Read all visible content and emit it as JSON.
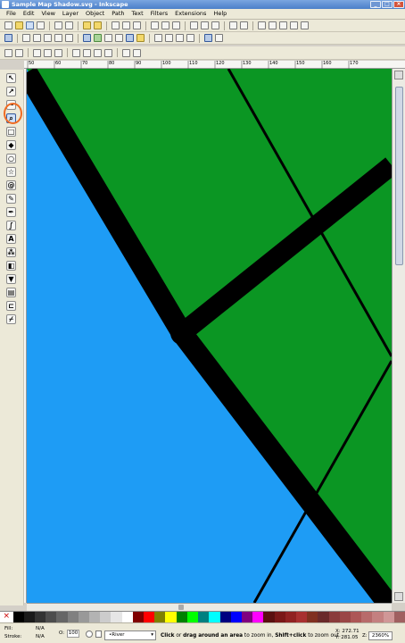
{
  "window": {
    "title": "Sample Map Shadow.svg - Inkscape",
    "minimize": "_",
    "maximize": "□",
    "close": "×"
  },
  "menus": [
    "File",
    "Edit",
    "View",
    "Layer",
    "Object",
    "Path",
    "Text",
    "Filters",
    "Extensions",
    "Help"
  ],
  "tools": [
    {
      "name": "selector-tool-icon",
      "glyph": "↖"
    },
    {
      "name": "node-tool-icon",
      "glyph": "↗"
    },
    {
      "name": "tweak-tool-icon",
      "glyph": "~"
    },
    {
      "name": "zoom-tool-icon",
      "glyph": "⌕",
      "active": true
    },
    {
      "name": "rectangle-tool-icon",
      "glyph": "□"
    },
    {
      "name": "3d-box-tool-icon",
      "glyph": "◆"
    },
    {
      "name": "ellipse-tool-icon",
      "glyph": "○"
    },
    {
      "name": "star-tool-icon",
      "glyph": "☆"
    },
    {
      "name": "spiral-tool-icon",
      "glyph": "@"
    },
    {
      "name": "pencil-tool-icon",
      "glyph": "✎"
    },
    {
      "name": "pen-tool-icon",
      "glyph": "✒"
    },
    {
      "name": "calligraphy-tool-icon",
      "glyph": "∫"
    },
    {
      "name": "text-tool-icon",
      "glyph": "A"
    },
    {
      "name": "spray-tool-icon",
      "glyph": "⁂"
    },
    {
      "name": "eraser-tool-icon",
      "glyph": "◧"
    },
    {
      "name": "paint-bucket-tool-icon",
      "glyph": "▼"
    },
    {
      "name": "gradient-tool-icon",
      "glyph": "▤"
    },
    {
      "name": "connector-tool-icon",
      "glyph": "⊏"
    },
    {
      "name": "dropper-tool-icon",
      "glyph": "⌿"
    }
  ],
  "ruler": {
    "top_labels": [
      "50",
      "60",
      "70",
      "80",
      "90",
      "100",
      "110",
      "120",
      "130",
      "140",
      "150",
      "160",
      "170"
    ]
  },
  "canvas": {
    "water_color": "#1e9cf5",
    "land_color": "#0b9623",
    "road_color": "#000000"
  },
  "palette": [
    "#000000",
    "#1a1a1a",
    "#333333",
    "#4d4d4d",
    "#666666",
    "#808080",
    "#999999",
    "#b3b3b3",
    "#cccccc",
    "#e6e6e6",
    "#ffffff",
    "#800000",
    "#ff0000",
    "#808000",
    "#ffff00",
    "#008000",
    "#00ff00",
    "#008080",
    "#00ffff",
    "#000080",
    "#0000ff",
    "#800080",
    "#ff00ff",
    "#5a1010",
    "#7a1818",
    "#902222",
    "#a83030",
    "#803020",
    "#6a2a2a",
    "#8a3b3b",
    "#9a4646",
    "#ad5656",
    "#b86b6b",
    "#c48080",
    "#d09797",
    "#a06060"
  ],
  "status": {
    "fill_label": "Fill:",
    "fill_value": "N/A",
    "stroke_label": "Stroke:",
    "stroke_value": "N/A",
    "opacity_label": "O:",
    "opacity_value": "100",
    "layer": "•River",
    "message_bold1": "Click",
    "message1": " or ",
    "message_bold2": "drag around an area",
    "message2": " to zoom in, ",
    "message_bold3": "Shift+click",
    "message3": " to zoom out.",
    "x_label": "X:",
    "x_value": "272.71",
    "y_label": "Y:",
    "y_value": "281.05",
    "zoom_label": "Z:",
    "zoom_value": "2360%"
  }
}
